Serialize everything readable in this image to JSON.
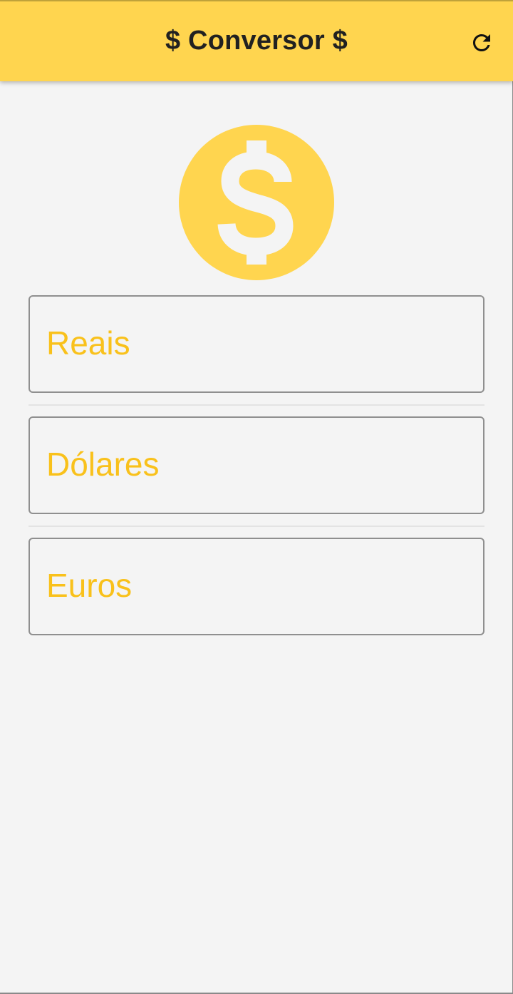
{
  "appbar": {
    "title": "$ Conversor $",
    "background_color": "#ffd54f",
    "refresh_icon": "refresh-icon"
  },
  "hero": {
    "icon": "dollar-coin-icon",
    "color": "#ffd54f"
  },
  "fields": [
    {
      "label": "Reais"
    },
    {
      "label": "Dólares"
    },
    {
      "label": "Euros"
    }
  ],
  "colors": {
    "accent": "#f9c11b",
    "field_border": "#8f8f8f",
    "background": "#f4f4f4"
  }
}
